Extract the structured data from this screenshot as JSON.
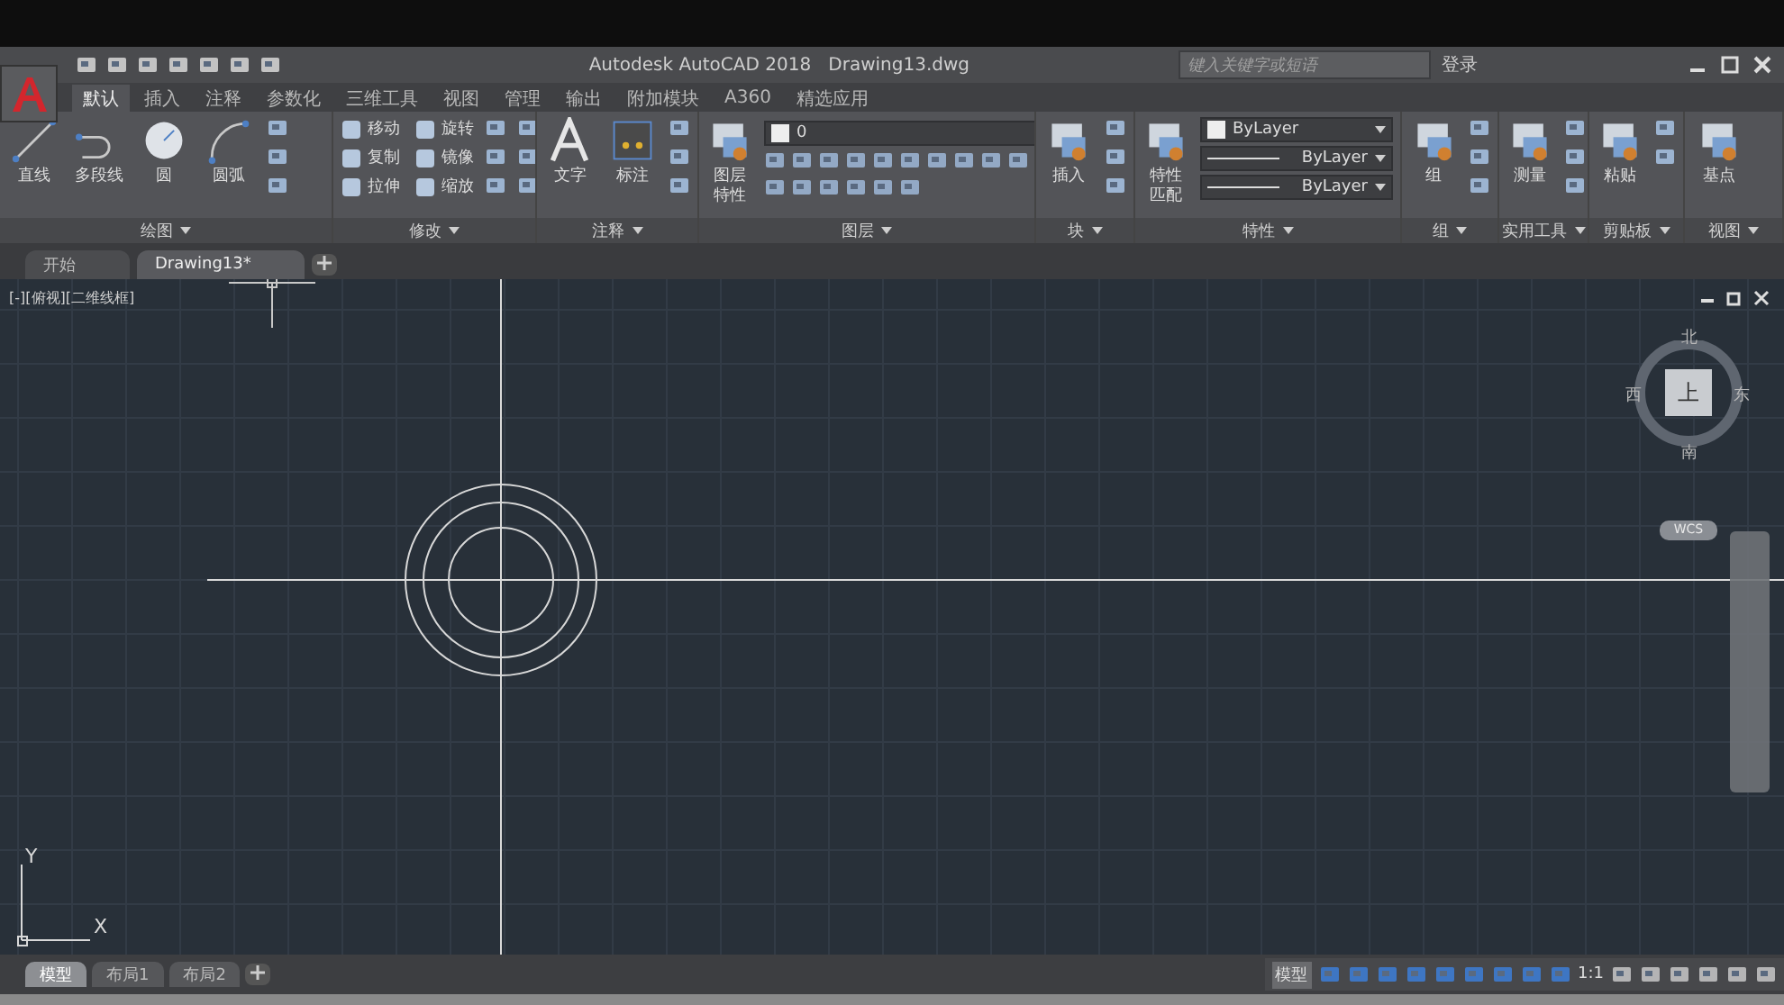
{
  "title_bar": {
    "app_title": "Autodesk AutoCAD 2018",
    "file_name": "Drawing13.dwg",
    "search": {
      "placeholder": "键入关键字或短语"
    },
    "login": "登录"
  },
  "ribbon_tabs": [
    {
      "label": "默认",
      "selected": true
    },
    {
      "label": "插入",
      "selected": false
    },
    {
      "label": "注释",
      "selected": false
    },
    {
      "label": "参数化",
      "selected": false
    },
    {
      "label": "三维工具",
      "selected": false
    },
    {
      "label": "视图",
      "selected": false
    },
    {
      "label": "管理",
      "selected": false
    },
    {
      "label": "输出",
      "selected": false
    },
    {
      "label": "附加模块",
      "selected": false
    },
    {
      "label": "A360",
      "selected": false
    },
    {
      "label": "精选应用",
      "selected": false
    }
  ],
  "panels": [
    {
      "title": "绘图",
      "tools": [
        {
          "kind": "large",
          "label": "直线"
        },
        {
          "kind": "large",
          "label": "多段线"
        },
        {
          "kind": "large",
          "label": "圆"
        },
        {
          "kind": "large",
          "label": "圆弧"
        }
      ]
    },
    {
      "title": "修改",
      "tools": [
        {
          "kind": "small",
          "label": "移动"
        },
        {
          "kind": "small",
          "label": "旋转"
        },
        {
          "kind": "small",
          "label": "复制"
        },
        {
          "kind": "small",
          "label": "镜像"
        },
        {
          "kind": "small",
          "label": "拉伸"
        },
        {
          "kind": "small",
          "label": "缩放"
        }
      ]
    },
    {
      "title": "注释",
      "tools": [
        {
          "kind": "large",
          "label": "文字"
        },
        {
          "kind": "large",
          "label": "标注"
        }
      ]
    },
    {
      "title": "图层",
      "tools": [
        {
          "kind": "large",
          "label": "图层特性"
        },
        {
          "kind": "combo",
          "value": "0"
        }
      ]
    },
    {
      "title": "块",
      "tools": [
        {
          "kind": "large",
          "label": "插入"
        }
      ]
    },
    {
      "title": "特性",
      "tools": [
        {
          "kind": "large",
          "label": "特性匹配"
        },
        {
          "kind": "combo",
          "value": "ByLayer"
        },
        {
          "kind": "combo",
          "value": "ByLayer"
        },
        {
          "kind": "combo",
          "value": "ByLayer"
        }
      ]
    },
    {
      "title": "组",
      "tools": [
        {
          "kind": "large",
          "label": "组"
        }
      ]
    },
    {
      "title": "实用工具",
      "tools": [
        {
          "kind": "large",
          "label": "测量"
        }
      ]
    },
    {
      "title": "剪贴板",
      "tools": [
        {
          "kind": "large",
          "label": "粘贴"
        }
      ]
    },
    {
      "title": "视图",
      "tools": [
        {
          "kind": "large",
          "label": "基点"
        }
      ]
    }
  ],
  "doc_tabs": [
    {
      "label": "开始",
      "selected": false
    },
    {
      "label": "Drawing13*",
      "selected": true
    }
  ],
  "viewport": {
    "label": "[-][俯视][二维线框]",
    "viewcube": {
      "north": "北",
      "south": "南",
      "east": "东",
      "west": "西",
      "face": "上",
      "ucs": "WCS"
    },
    "axis": {
      "x": "X",
      "y": "Y"
    }
  },
  "layout_tabs": [
    {
      "label": "模型",
      "selected": true
    },
    {
      "label": "布局1",
      "selected": false
    },
    {
      "label": "布局2",
      "selected": false
    }
  ],
  "status_bar": {
    "model": "模型",
    "scale": "1:1"
  }
}
